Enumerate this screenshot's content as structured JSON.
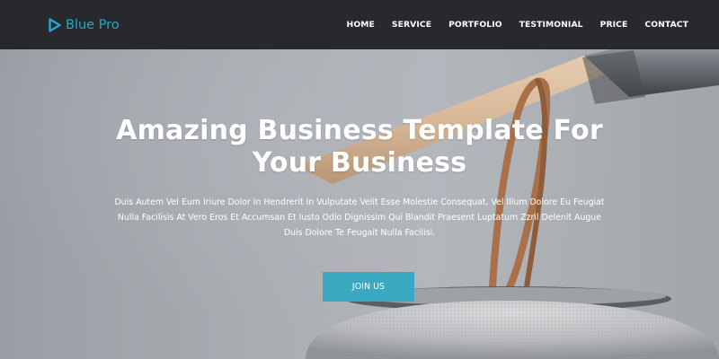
{
  "brand": {
    "name": "Blue Pro",
    "icon": "play-triangle-icon",
    "color": "#2aa6c8"
  },
  "nav": {
    "items": [
      "HOME",
      "SERVICE",
      "PORTFOLIO",
      "TESTIMONIAL",
      "PRICE",
      "CONTACT"
    ]
  },
  "hero": {
    "title": "Amazing Business Template For Your Business",
    "description": "Duis Autem Vel Eum Iriure Dolor In Hendrerit In Vulputate Velit Esse Molestie Consequat, Vel Illum Dolore Eu Feugiat Nulla Facilisis At Vero Eros Et Accumsan Et Iusto Odio Dignissim Qui Blandit Praesent Luptatum Zzril Delenit Augue Duis Dolore Te Feugait Nulla Facilisi.",
    "cta_label": "JOIN US",
    "cta_color": "#3aa8c1"
  },
  "colors": {
    "navbar_bg": "#27292c",
    "text": "#ffffff"
  }
}
